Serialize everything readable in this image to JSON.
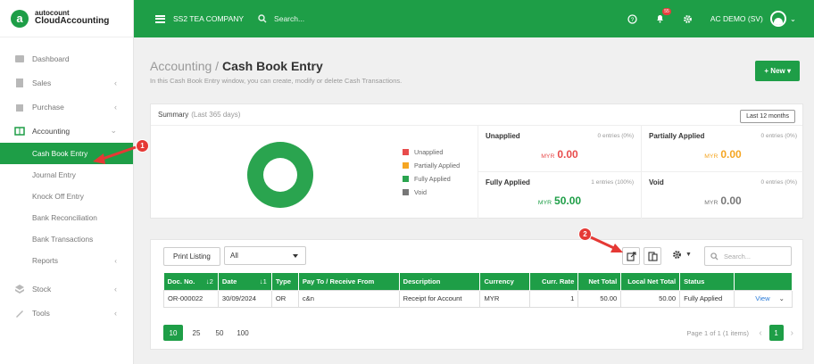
{
  "brand": {
    "line1": "autocount",
    "line2": "CloudAccounting",
    "logo_letter": "a"
  },
  "topbar": {
    "company": "SS2 TEA COMPANY",
    "search_placeholder": "Search...",
    "notif_count": "55",
    "user": "AC DEMO (SV)"
  },
  "sidebar": {
    "items": [
      {
        "label": "Dashboard",
        "icon": "dashboard-icon"
      },
      {
        "label": "Sales",
        "icon": "sales-icon",
        "chevron": "‹"
      },
      {
        "label": "Purchase",
        "icon": "purchase-icon",
        "chevron": "‹"
      },
      {
        "label": "Accounting",
        "icon": "accounting-icon",
        "chevron": "⌄"
      },
      {
        "label": "Stock",
        "icon": "stock-icon",
        "chevron": "‹"
      },
      {
        "label": "Tools",
        "icon": "tools-icon",
        "chevron": "‹"
      }
    ],
    "accounting_sub": [
      "Cash Book Entry",
      "Journal Entry",
      "Knock Off Entry",
      "Bank Reconciliation",
      "Bank Transactions",
      "Reports"
    ]
  },
  "page": {
    "section": "Accounting",
    "slash": " / ",
    "title": "Cash Book Entry",
    "description": "In this Cash Book Entry window, you can create, modify or delete Cash Transactions.",
    "new_button": "+ New ▾"
  },
  "summary": {
    "title": "Summary",
    "period": "(Last 365 days)",
    "range_button": "Last 12 months",
    "legend": [
      {
        "label": "Unapplied",
        "color": "#e84c4c"
      },
      {
        "label": "Partially Applied",
        "color": "#f5a623"
      },
      {
        "label": "Fully Applied",
        "color": "#2aa44f"
      },
      {
        "label": "Void",
        "color": "#777777"
      }
    ],
    "stats": [
      {
        "label": "Unapplied",
        "entries": "0 entries (0%)",
        "currency": "MYR",
        "value": "0.00",
        "color": "#e84c4c"
      },
      {
        "label": "Partially Applied",
        "entries": "0 entries (0%)",
        "currency": "MYR",
        "value": "0.00",
        "color": "#f5a623"
      },
      {
        "label": "Fully Applied",
        "entries": "1 entries (100%)",
        "currency": "MYR",
        "value": "50.00",
        "color": "#1e9e47"
      },
      {
        "label": "Void",
        "entries": "0 entries (0%)",
        "currency": "MYR",
        "value": "0.00",
        "color": "#777777"
      }
    ]
  },
  "listing": {
    "print_button": "Print Listing",
    "filter_value": "All",
    "search_placeholder": "Search...",
    "columns": [
      "Doc. No.",
      "Date",
      "Type",
      "Pay To / Receive From",
      "Description",
      "Currency",
      "Curr. Rate",
      "Net Total",
      "Local Net Total",
      "Status",
      ""
    ],
    "sort_icons": [
      "↓2",
      "↓1"
    ],
    "rows": [
      [
        "OR-000022",
        "30/09/2024",
        "OR",
        "c&n",
        "Receipt for Account",
        "MYR",
        "1",
        "50.00",
        "50.00",
        "Fully Applied",
        "View"
      ]
    ],
    "page_sizes": [
      "10",
      "25",
      "50",
      "100"
    ],
    "page_info": "Page 1 of 1 (1 items)",
    "current_page": "1"
  },
  "markers": [
    "1",
    "2"
  ]
}
